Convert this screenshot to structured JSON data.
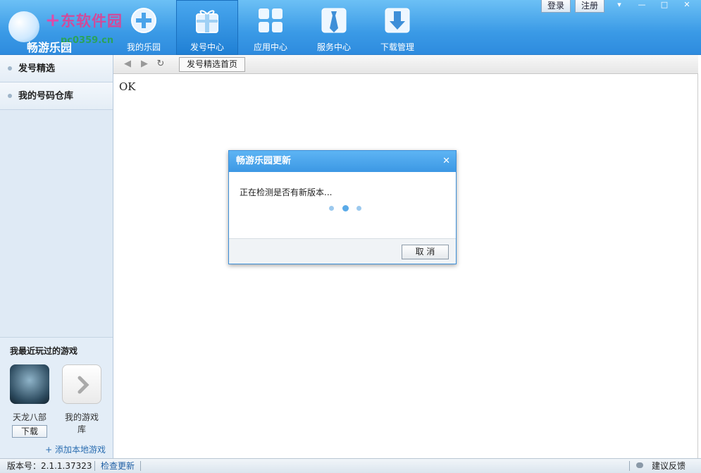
{
  "header": {
    "watermark": "东软件园",
    "watermark_url": "pc0359.cn",
    "brand": "畅游乐园",
    "tabs": [
      {
        "label": "我的乐园",
        "icon": "gamepad-icon"
      },
      {
        "label": "发号中心",
        "icon": "gift-icon"
      },
      {
        "label": "应用中心",
        "icon": "apps-grid-icon"
      },
      {
        "label": "服务中心",
        "icon": "tie-icon"
      },
      {
        "label": "下载管理",
        "icon": "download-arrow-icon"
      }
    ],
    "login_label": "登录",
    "register_label": "注册"
  },
  "sidebar": {
    "items": [
      {
        "label": "发号精选"
      },
      {
        "label": "我的号码仓库"
      }
    ],
    "recent_title": "我最近玩过的游戏",
    "games": [
      {
        "name": "天龙八部",
        "action": "下载"
      },
      {
        "name": "我的游戏库"
      }
    ],
    "add_local": "+ 添加本地游戏"
  },
  "toolbar": {
    "current_tab": "发号精选首页"
  },
  "content": {
    "text": "OK"
  },
  "dialog": {
    "title": "畅游乐园更新",
    "message": "正在检测是否有新版本...",
    "cancel": "取 消"
  },
  "status": {
    "version": "版本号：2.1.1.37323",
    "check_update": "检查更新",
    "feedback": "建议反馈"
  },
  "colors": {
    "header_blue": "#3a9ae6",
    "dialog_head": "#4aa6ec"
  }
}
